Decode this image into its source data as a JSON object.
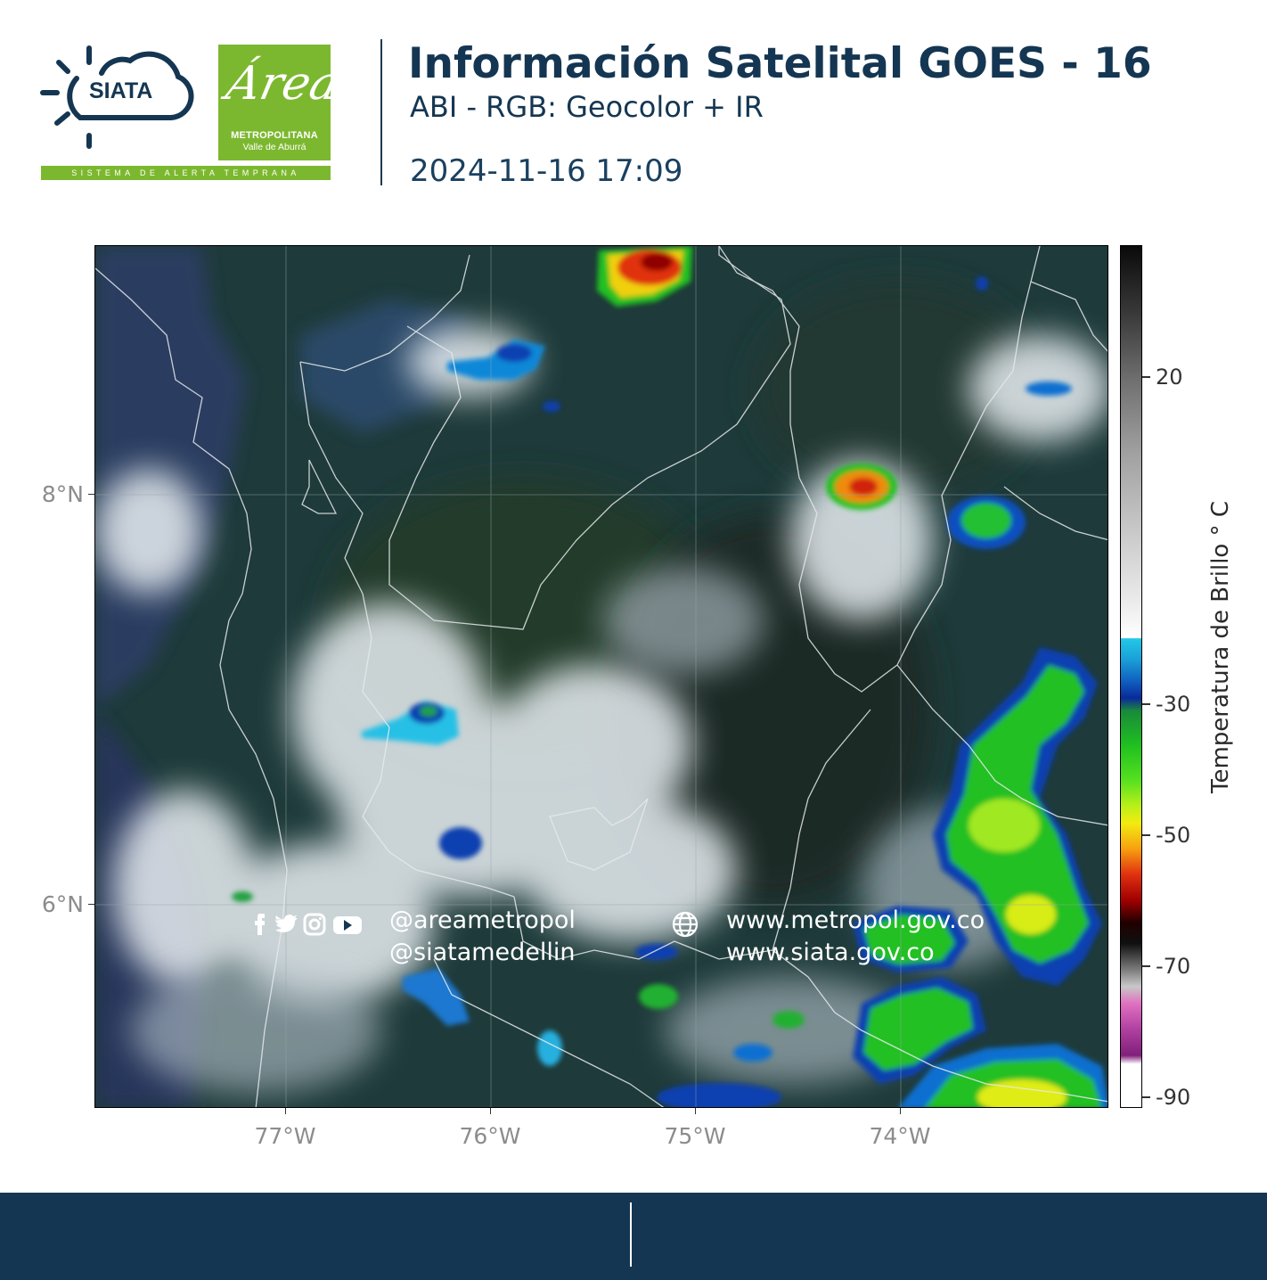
{
  "header": {
    "title": "Información Satelital GOES - 16",
    "subtitle": "ABI - RGB: Geocolor + IR",
    "datetime": "2024-11-16 17:09"
  },
  "logos": {
    "siata_text": "SIATA",
    "siata_tagline": "SISTEMA DE ALERTA TEMPRANA",
    "area_script": "Área",
    "area_line1": "METROPOLITANA",
    "area_line2": "Valle de Aburrá",
    "accent_color": "#7cb82f"
  },
  "map": {
    "lat_labels": [
      "8°N",
      "6°N"
    ],
    "lon_labels": [
      "77°W",
      "76°W",
      "75°W",
      "74°W"
    ],
    "cloud_tops": [
      {
        "category": "-60 °C core",
        "lon": -75.2
      },
      {
        "category": "-60 °C core",
        "lon": -74.2
      },
      {
        "category": "-30 °C",
        "lon": -76.3
      },
      {
        "category": "-40 °C",
        "lon": -73.5
      }
    ]
  },
  "colorbar": {
    "title": "Temperatura de Brillo ° C",
    "ticks": [
      "20",
      "-30",
      "-50",
      "-70",
      "-90"
    ],
    "range": [
      30,
      -90
    ]
  },
  "footer": {
    "handles": [
      "@areametropol",
      "@siatamedellin"
    ],
    "urls": [
      "www.metropol.gov.co",
      "www.siata.gov.co"
    ],
    "background_color": "#143652"
  }
}
